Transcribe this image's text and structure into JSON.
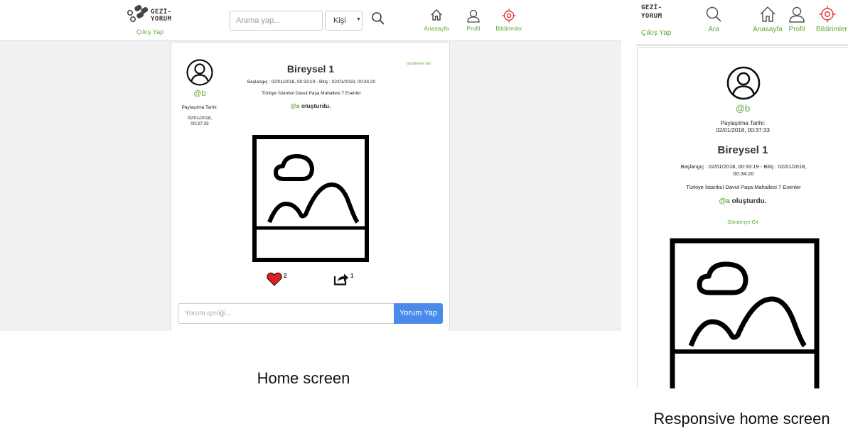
{
  "desktop": {
    "logo_line1": "GEZİ-",
    "logo_line2": "YORUM",
    "logout": "Çıkış Yap",
    "search": {
      "placeholder": "Arama yap..."
    },
    "filter_selected": "Kişi",
    "nav": [
      {
        "label": "Anasayfa",
        "icon": "home-icon"
      },
      {
        "label": "Profil",
        "icon": "user-icon"
      },
      {
        "label": "Bildirimler",
        "icon": "target-icon"
      }
    ],
    "post": {
      "username": "@b",
      "share_date_label": "Paylaşılma Tarihi:",
      "share_date": "02/01/2018, 00:37:33",
      "title": "Bireysel 1",
      "dates": "Başlangıç : 02/01/2018, 00:33:19 - Bitiş : 02/01/2018, 00:34:20",
      "location": "Türkiye İstanbul Davut Paşa Mahallesi 7 Esenler",
      "creator": "@a",
      "created_text": "oluşturdu.",
      "go_to_post": "Gönderiye Git",
      "likes": "2",
      "shares": "1",
      "comment_placeholder": "Yorum içeriği...",
      "comment_button": "Yorum Yap"
    },
    "caption": "Home screen"
  },
  "mobile": {
    "logo_line1": "GEZİ-",
    "logo_line2": "YORUM",
    "logout": "Çıkış Yap",
    "nav": [
      {
        "label": "Ara",
        "icon": "search-icon"
      },
      {
        "label": "Anasayfa",
        "icon": "home-icon"
      },
      {
        "label": "Profil",
        "icon": "user-icon"
      },
      {
        "label": "Bildirimler",
        "icon": "target-icon"
      }
    ],
    "post": {
      "username": "@b",
      "share_date_label": "Paylaşılma Tarihi:",
      "share_date": "02/01/2018, 00:37:33",
      "title": "Bireysel 1",
      "dates_line1": "Başlangıç : 02/01/2018, 00:33:19 - Bitiş : 02/01/2018,",
      "dates_line2": "00:34:20",
      "location": "Türkiye İstanbul Davut Paşa Mahallesi 7 Esenler",
      "creator": "@a",
      "created_text": "oluşturdu.",
      "go_to_post": "Gönderiye Git"
    },
    "caption": "Responsive home screen"
  },
  "colors": {
    "accent_green": "#5fa83a",
    "button_blue": "#4a8bea",
    "heart_red": "#e02020",
    "target_red": "#e83a3a"
  }
}
